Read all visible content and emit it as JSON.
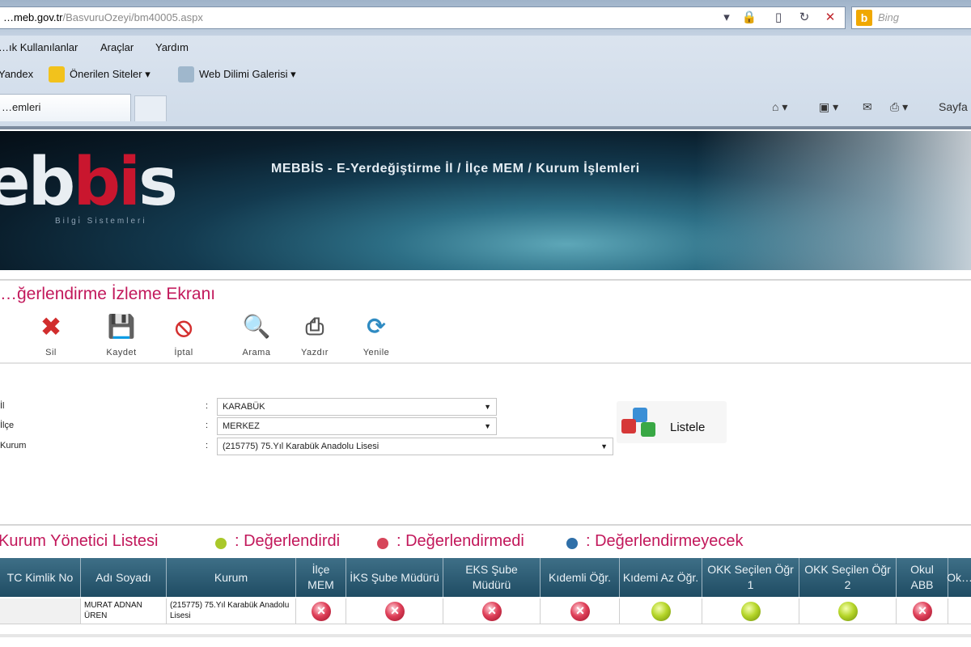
{
  "browser": {
    "address_host": "…meb.gov.tr",
    "address_path": "/BasvuruOzeyi/bm40005.aspx",
    "search_placeholder": "Bing",
    "menu": [
      "…ık Kullanılanlar",
      "Araçlar",
      "Yardım"
    ],
    "favorites": [
      "Yandex",
      "Önerilen Siteler ▾",
      "Web Dilimi Galerisi ▾"
    ],
    "tab_title": "…emleri",
    "page_menu": "Sayfa"
  },
  "banner": {
    "logo_prefix": "eb",
    "logo_accent": "bi",
    "logo_suffix": "s",
    "logo_sub": "Bilgi̇ Sistemleri",
    "title": "MEBBİS - E-Yerdeğiştirme İl / İlçe MEM / Kurum İşlemleri"
  },
  "page": {
    "title": "…ğerlendirme İzleme Ekranı"
  },
  "toolbar": {
    "buttons": [
      {
        "label": "Sil",
        "icon": "delete-icon"
      },
      {
        "label": "Kaydet",
        "icon": "save-icon"
      },
      {
        "label": "İptal",
        "icon": "cancel-icon"
      },
      {
        "label": "Arama",
        "icon": "search-icon"
      },
      {
        "label": "Yazdır",
        "icon": "print-icon"
      },
      {
        "label": "Yenile",
        "icon": "refresh-icon"
      }
    ]
  },
  "form": {
    "fields": [
      {
        "label": "İl",
        "value": "KARABÜK"
      },
      {
        "label": "İlçe",
        "value": "MERKEZ"
      },
      {
        "label": "Kurum",
        "value": "(215775) 75.Yıl Karabük Anadolu Lisesi"
      }
    ],
    "list_button": "Listele"
  },
  "list": {
    "title": "Kurum Yönetici Listesi",
    "legend": [
      {
        "label": ": Değerlendirdi",
        "color": "#a9c82a"
      },
      {
        "label": ": Değerlendirmedi",
        "color": "#d6455a"
      },
      {
        "label": ": Değerlendirmeyecek",
        "color": "#2f6fa8"
      }
    ],
    "columns": [
      "TC Kimlik No",
      "Adı Soyadı",
      "Kurum",
      "İlçe MEM",
      "İKS Şube Müdürü",
      "EKS Şube Müdürü",
      "Kıdemli Öğr.",
      "Kıdemi Az Öğr.",
      "OKK Seçilen Öğr 1",
      "OKK Seçilen Öğr 2",
      "Okul ABB",
      "Ok…"
    ],
    "rows": [
      {
        "tc": "",
        "name": "MURAT ADNAN ÜREN",
        "kurum": "(215775) 75.Yıl Karabük Anadolu Lisesi",
        "statuses": [
          "no",
          "no",
          "no",
          "no",
          "yes",
          "yes",
          "yes",
          "no"
        ]
      }
    ]
  },
  "colors": {
    "accent_title": "#c2185b",
    "header_bg": "#2a5a72",
    "banner_dark": "#0a1e2c"
  }
}
